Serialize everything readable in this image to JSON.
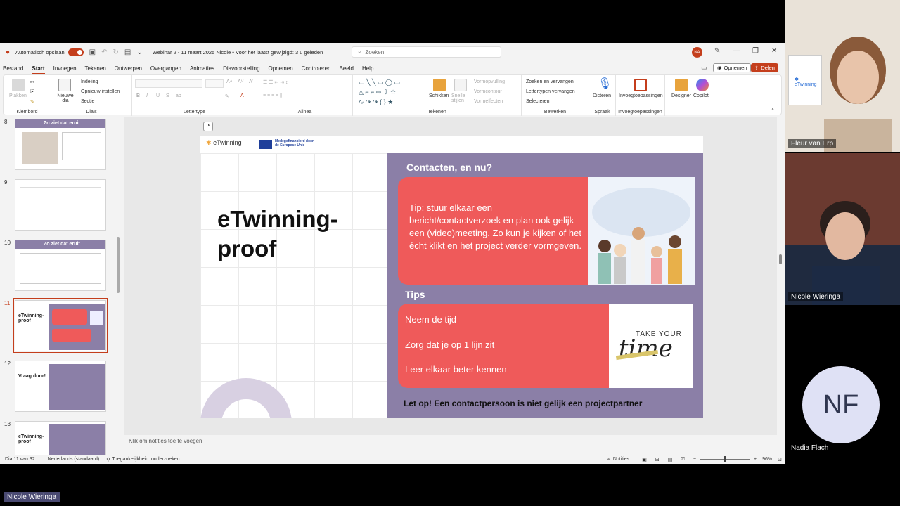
{
  "titlebar": {
    "autosave_label": "Automatisch opslaan",
    "doc_title": "Webinar 2 - 11 maart 2025 Nicole • Voor het laatst gewijzigd: 3 u geleden",
    "search_placeholder": "Zoeken",
    "user_initials": "NA"
  },
  "menu": {
    "items": [
      "Bestand",
      "Start",
      "Invoegen",
      "Tekenen",
      "Ontwerpen",
      "Overgangen",
      "Animaties",
      "Diavoorstelling",
      "Opnemen",
      "Controleren",
      "Beeld",
      "Help"
    ],
    "record_label": "Opnemen",
    "share_label": "Delen"
  },
  "ribbon": {
    "clipboard": {
      "paste": "Plakken",
      "label": "Klembord"
    },
    "slides": {
      "new_slide": "Nieuwe dia",
      "layout": "Indeling",
      "reset": "Opnieuw instellen",
      "section": "Sectie",
      "label": "Dia's"
    },
    "font": {
      "label": "Lettertype",
      "bold": "B",
      "italic": "I",
      "underline": "U",
      "strike": "S",
      "ab": "ab"
    },
    "paragraph": {
      "label": "Alinea"
    },
    "drawing": {
      "arrange": "Schikken",
      "quick_styles": "Snelle stijlen",
      "fill": "Vormopvulling",
      "outline": "Vormcontour",
      "effects": "Vormeffecten",
      "label": "Tekenen"
    },
    "editing": {
      "find_replace": "Zoeken en vervangen",
      "replace_fonts": "Lettertypen vervangen",
      "select": "Selecteren",
      "label": "Bewerken"
    },
    "voice": {
      "dictate": "Dicteren",
      "label": "Spraak"
    },
    "addins": {
      "addins": "Invoegtoepassingen",
      "label": "Invoegtoepassingen"
    },
    "designer": "Designer",
    "copilot": "Copilot"
  },
  "thumbnails": [
    {
      "num": "8",
      "title": "Zo ziet dat eruit"
    },
    {
      "num": "9",
      "title": ""
    },
    {
      "num": "10",
      "title": "Zo ziet dat eruit"
    },
    {
      "num": "11",
      "title": "eTwinning-proof"
    },
    {
      "num": "12",
      "title": "Vraag door!"
    },
    {
      "num": "13",
      "title": "eTwinning-proof"
    }
  ],
  "slide": {
    "brand": "eTwinning",
    "eu_text_1": "Medegefinancierd door",
    "eu_text_2": "de Europese Unie",
    "title": "eTwinning-proof",
    "contacts_heading": "Contacten, en nu?",
    "tip_text": "Tip: stuur elkaar een bericht/contactverzoek en plan ook gelijk een (video)meeting. Zo kun je kijken of het écht klikt en het project verder vormgeven.",
    "tips_heading": "Tips",
    "tips": [
      "Neem de tijd",
      "Zorg dat je op 1 lijn zit",
      "Leer elkaar beter kennen"
    ],
    "take_your": "TAKE YOUR",
    "time_word": "time",
    "warning": "Let op! Een contactpersoon is niet gelijk een projectpartner"
  },
  "notes_placeholder": "Klik om notities toe te voegen",
  "status": {
    "slide_count": "Dia 11 van 32",
    "language": "Nederlands (standaard)",
    "accessibility": "Toegankelijkheid: onderzoeken",
    "notes": "Notities",
    "zoom": "96%"
  },
  "participants": [
    {
      "name": "Fleur van Erp"
    },
    {
      "name": "Nicole Wieringa"
    },
    {
      "name": "Nadia Flach",
      "initials": "NF"
    }
  ],
  "presenter_label": "Nicole Wieringa",
  "colors": {
    "accent": "#c43e1c",
    "slide_purple": "#8b7fa7",
    "slide_coral": "#ef5a5a"
  }
}
